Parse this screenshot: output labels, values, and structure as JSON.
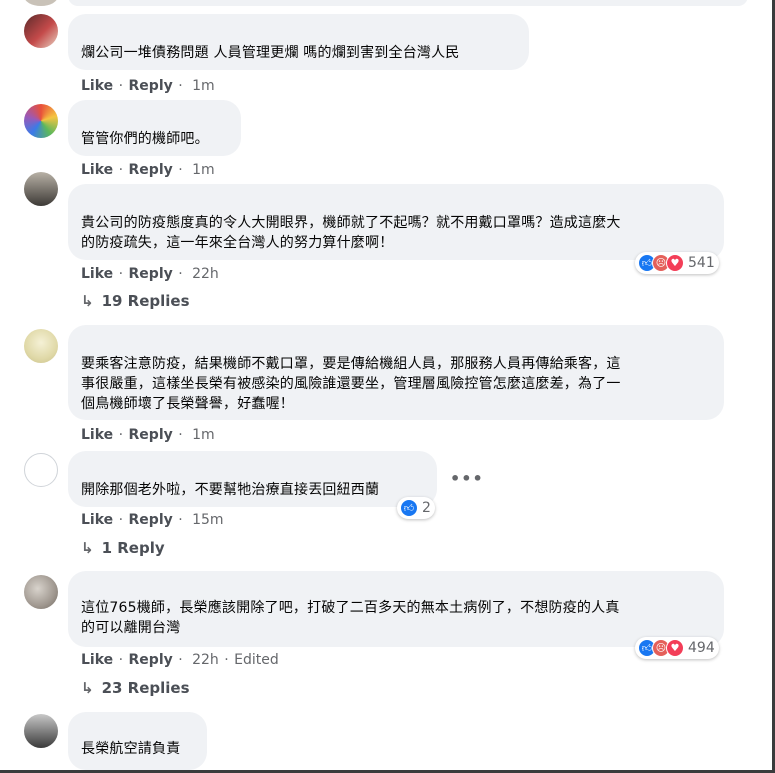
{
  "comments": [
    {
      "text": "爛公司一堆債務問題 人員管理更爛 嗎的爛到害到全台灣人民",
      "like": "Like",
      "reply": "Reply",
      "time": "1m"
    },
    {
      "text": "管管你們的機師吧。",
      "like": "Like",
      "reply": "Reply",
      "time": "1m"
    },
    {
      "text_lines": [
        "貴公司的防疫態度真的令人大開眼界，機師就了不起嗎？就不用戴口罩嗎？造成這麼大",
        "的防疫疏失，這一年來全台灣人的努力算什麼啊！"
      ],
      "like": "Like",
      "reply": "Reply",
      "time": "22h",
      "reaction_count": "541",
      "replies": "19 Replies"
    },
    {
      "text_lines": [
        "要乘客注意防疫，結果機師不戴口罩，要是傳給機組人員，那服務人員再傳給乘客，這",
        "事很嚴重，這樣坐長榮有被感染的風險誰還要坐，管理層風險控管怎麼這麼差，為了一",
        "個鳥機師壞了長榮聲譽，好蠢喔！"
      ],
      "like": "Like",
      "reply": "Reply",
      "time": "1m"
    },
    {
      "text": "開除那個老外啦，不要幫牠治療直接丟回紐西蘭",
      "like": "Like",
      "reply": "Reply",
      "time": "15m",
      "reaction_count": "2",
      "replies": "1 Reply"
    },
    {
      "text_lines": [
        "這位765機師，長榮應該開除了吧，打破了二百多天的無本土病例了，不想防疫的人真",
        "的可以離開台灣"
      ],
      "like": "Like",
      "reply": "Reply",
      "time": "22h",
      "edited": "Edited",
      "reaction_count": "494",
      "replies": "23 Replies"
    },
    {
      "text": "長榮航空請負責"
    }
  ],
  "icons": {
    "like": "like-reaction-icon",
    "haha": "haha-reaction-icon",
    "angry": "angry-reaction-icon",
    "love": "love-reaction-icon",
    "reply_arrow": "reply-arrow-icon",
    "more": "more-options-icon"
  },
  "colors": {
    "bubble": "#f0f2f5",
    "action_text": "#4b4f56",
    "meta_text": "#65676b",
    "like_blue": "#1877f2"
  }
}
